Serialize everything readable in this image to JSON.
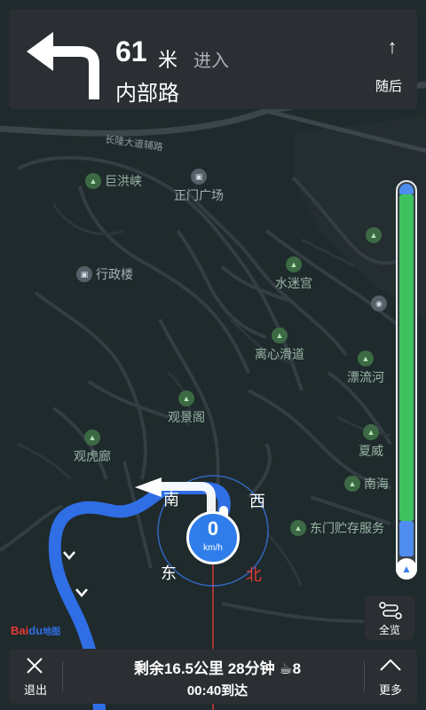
{
  "guidance": {
    "distance": "61",
    "distance_unit": "米",
    "action": "进入",
    "road_name": "内部路",
    "next_label": "随后",
    "next_arrow": "↑",
    "turn_icon": "turn-left-icon"
  },
  "map": {
    "road_labels": [
      "长隆大道辅路"
    ],
    "pois": [
      {
        "name": "巨洪峡",
        "icon": "park-icon"
      },
      {
        "name": "正门广场",
        "icon": "building-icon"
      },
      {
        "name": "行政楼",
        "icon": "building-icon"
      },
      {
        "name": "水迷宫",
        "icon": "park-icon"
      },
      {
        "name": "离心滑道",
        "icon": "park-icon"
      },
      {
        "name": "漂流河",
        "icon": "park-icon"
      },
      {
        "name": "观景阁",
        "icon": "park-icon"
      },
      {
        "name": "观虎廊",
        "icon": "park-icon"
      },
      {
        "name": "夏威",
        "icon": "park-icon"
      },
      {
        "name": "南海",
        "icon": "park-icon"
      },
      {
        "name": "东门贮存服务",
        "icon": "park-icon"
      }
    ]
  },
  "compass": {
    "south": "南",
    "west": "西",
    "east": "东",
    "north": "北"
  },
  "speed": {
    "value": "0",
    "unit": "km/h"
  },
  "progress": {
    "traveled_fraction": 0.1
  },
  "overview": {
    "label": "全览",
    "icon": "route-overview-icon"
  },
  "logo": {
    "text": "Bai",
    "paw": "du",
    "suffix": "地图"
  },
  "bottom_bar": {
    "exit_label": "退出",
    "remaining": "剩余16.5公里 28分钟 ☕8",
    "arrival": "00:40到达",
    "more_label": "更多"
  },
  "colors": {
    "route": "#2f6ee5",
    "progress_green": "#3ec25f",
    "north": "#e53935",
    "panel": "#2b2f33",
    "map_bg": "#1f2a2c"
  }
}
